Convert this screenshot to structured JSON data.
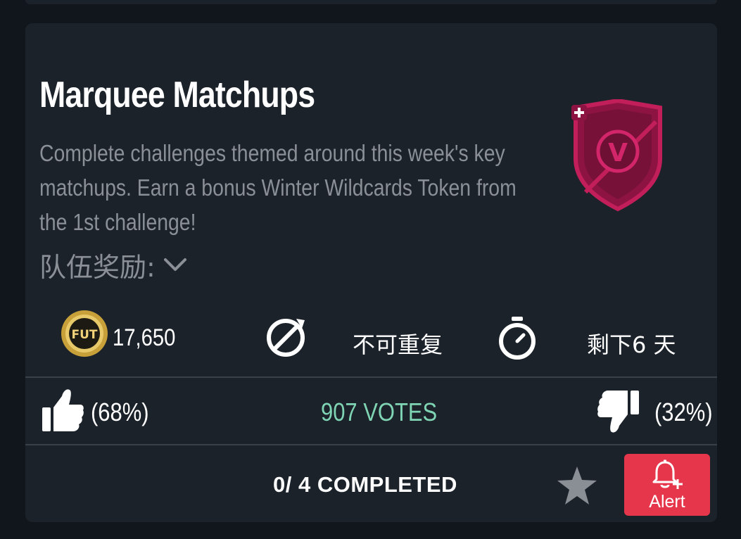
{
  "challenge": {
    "title": "Marquee Matchups",
    "description": "Complete challenges themed around this week's key matchups. Earn a bonus Winter Wildcards Token from the 1st challenge!",
    "team_reward_label": "队伍奖励:",
    "badge_letter": "V"
  },
  "stats": {
    "coin_label": "FUT",
    "coin_value": "17,650",
    "repeat_label": "不可重复",
    "time_left_label": "剩下6 天"
  },
  "votes": {
    "up_percent": "(68%)",
    "total": "907 VOTES",
    "down_percent": "(32%)"
  },
  "footer": {
    "completed": "0/ 4 COMPLETED",
    "alert_label": "Alert"
  },
  "colors": {
    "background": "#11161c",
    "card": "#1b222a",
    "votes_text": "#7fd4b4",
    "alert_button": "#e6364b",
    "badge": "#c21e5a"
  },
  "icons": [
    "fut-coin-icon",
    "no-repeat-icon",
    "stopwatch-icon",
    "thumbs-up-icon",
    "thumbs-down-icon",
    "star-icon",
    "bell-plus-icon",
    "chevron-down-icon"
  ]
}
